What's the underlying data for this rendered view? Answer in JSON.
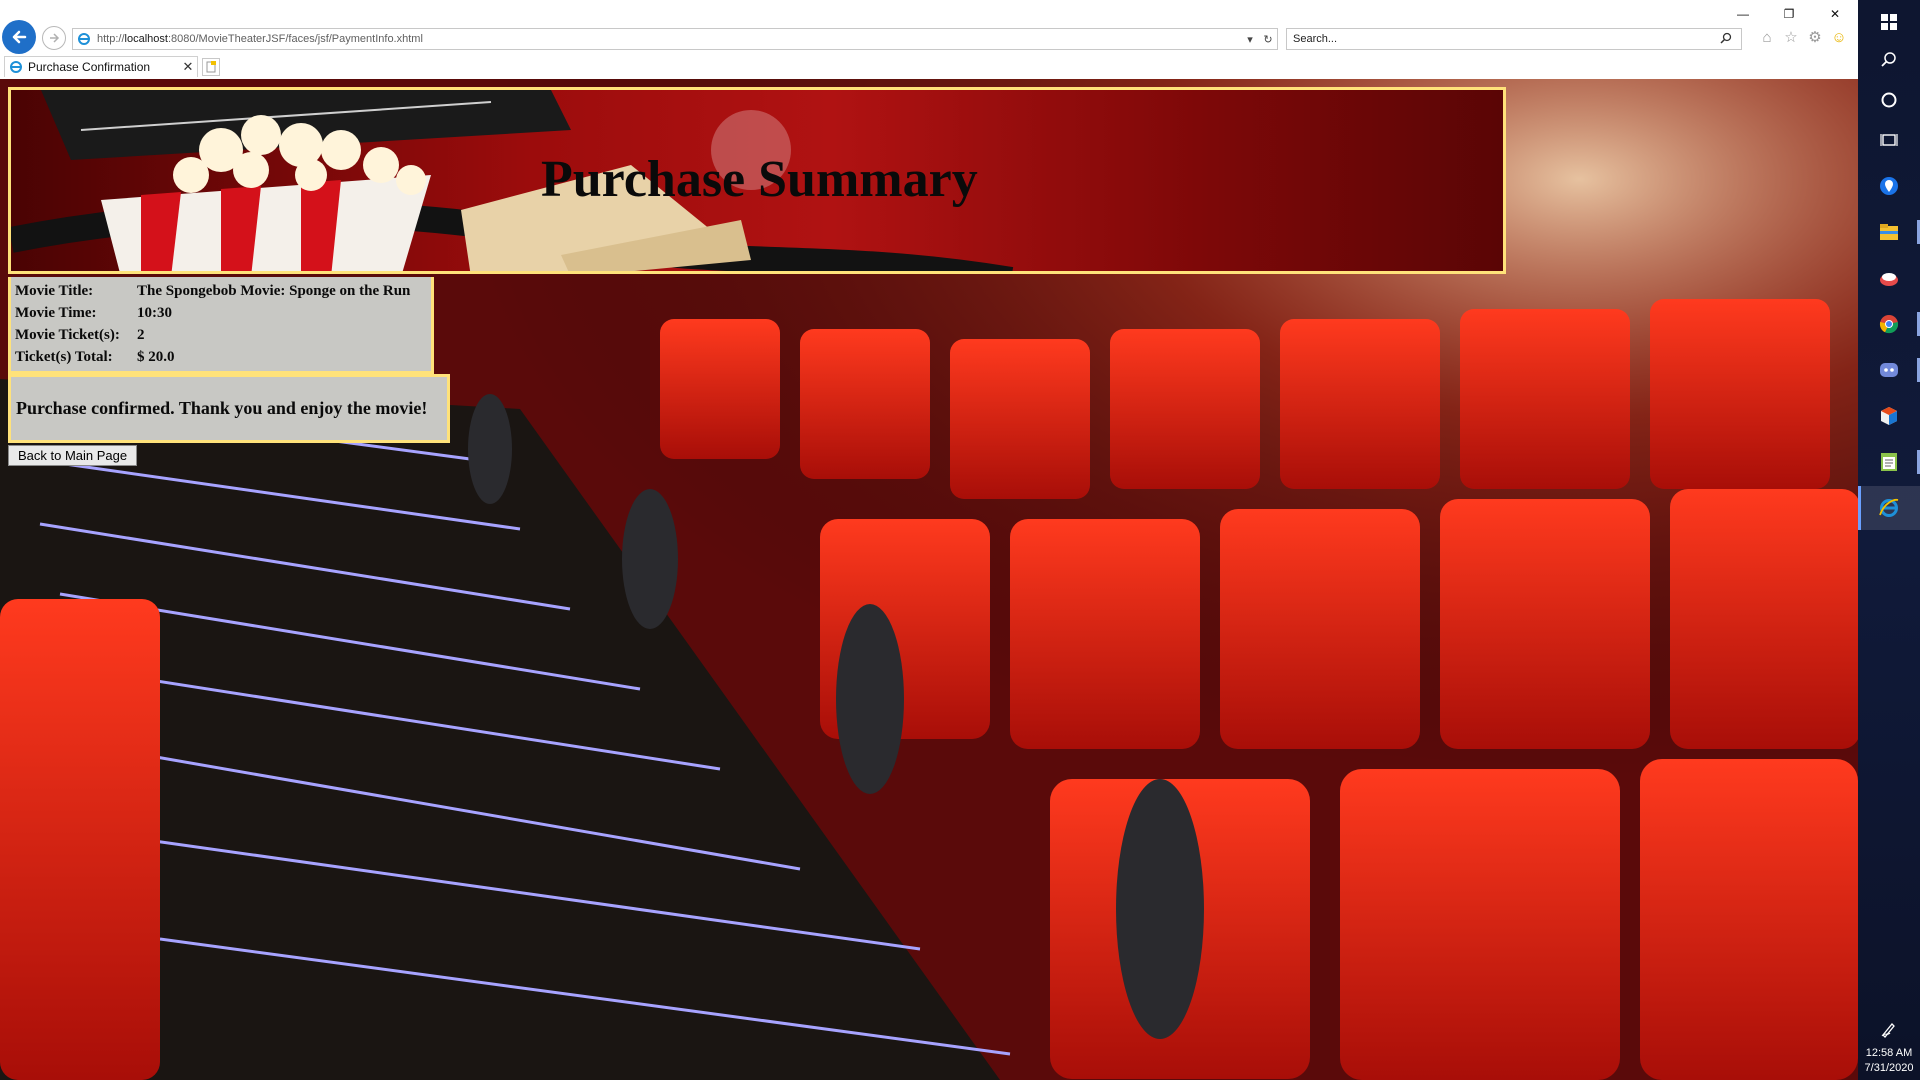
{
  "browser": {
    "address": {
      "url_prefix": "http://",
      "url_host": "localhost",
      "url_rest": ":8080/MovieTheaterJSF/faces/jsf/PaymentInfo.xhtml",
      "dropdown_glyph": "▾",
      "refresh_glyph": "↻"
    },
    "search": {
      "placeholder": "Search..."
    },
    "tab": {
      "title": "Purchase Confirmation",
      "close_glyph": "✕"
    },
    "window_controls": {
      "minimize": "—",
      "restore": "❐",
      "close": "✕"
    },
    "tool_icons": [
      "home-icon",
      "favorites-star-icon",
      "settings-gear-icon",
      "feedback-smiley-icon"
    ]
  },
  "page": {
    "banner_title": "Purchase Summary",
    "summary": [
      {
        "label": "Movie Title:",
        "value": "The Spongebob Movie: Sponge on the Run"
      },
      {
        "label": "Movie Time:",
        "value": "10:30"
      },
      {
        "label": "Movie Ticket(s):",
        "value": "2"
      },
      {
        "label": "Ticket(s) Total:",
        "value": "$ 20.0"
      }
    ],
    "confirmation": "Purchase confirmed. Thank you and enjoy the movie!",
    "back_button": "Back to Main Page"
  },
  "taskbar": {
    "items": [
      "start-icon",
      "search-icon",
      "cortana-icon",
      "task-view-icon",
      "maps-icon",
      "file-explorer-icon",
      "app-icon",
      "chrome-icon",
      "discord-icon",
      "app-cube-icon",
      "notepad-icon",
      "internet-explorer-icon"
    ],
    "clock_time": "12:58 AM",
    "clock_date": "7/31/2020"
  },
  "colors": {
    "panel_border": "#ffe27a",
    "panel_bg": "#c8c8c4",
    "back_button_blue": "#1f6fc8",
    "taskbar_bg": "#101a3a"
  }
}
